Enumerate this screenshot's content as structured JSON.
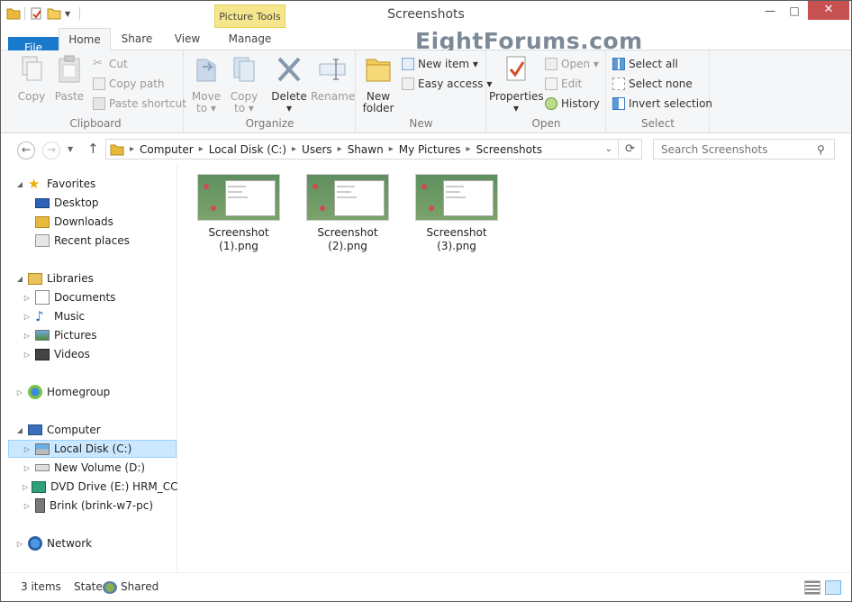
{
  "window": {
    "title": "Screenshots",
    "context_tab": "Picture Tools",
    "minimize_label": "—",
    "maximize_label": "□",
    "close_label": "✕"
  },
  "tabs": [
    "File",
    "Home",
    "Share",
    "View",
    "Manage"
  ],
  "watermark": "EightForums.com",
  "ribbon": {
    "clipboard": {
      "label": "Clipboard",
      "copy": "Copy",
      "paste": "Paste",
      "cut": "Cut",
      "copy_path": "Copy path",
      "paste_shortcut": "Paste shortcut"
    },
    "organize": {
      "label": "Organize",
      "move_to": [
        "Move",
        "to ▾"
      ],
      "copy_to": [
        "Copy",
        "to ▾"
      ],
      "delete": [
        "Delete",
        "▾"
      ],
      "rename": "Rename"
    },
    "new": {
      "label": "New",
      "new_folder": [
        "New",
        "folder"
      ],
      "new_item": "New item ▾",
      "easy_access": "Easy access ▾"
    },
    "open": {
      "label": "Open",
      "properties": [
        "Properties",
        "▾"
      ],
      "open": "Open ▾",
      "edit": "Edit",
      "history": "History"
    },
    "select": {
      "label": "Select",
      "select_all": "Select all",
      "select_none": "Select none",
      "invert_selection": "Invert selection"
    }
  },
  "address": {
    "crumbs": [
      "Computer",
      "Local Disk (C:)",
      "Users",
      "Shawn",
      "My Pictures",
      "Screenshots"
    ],
    "search_placeholder": "Search Screenshots"
  },
  "nav": {
    "favorites": "Favorites",
    "desktop": "Desktop",
    "downloads": "Downloads",
    "recent": "Recent places",
    "libraries": "Libraries",
    "documents": "Documents",
    "music": "Music",
    "pictures": "Pictures",
    "videos": "Videos",
    "homegroup": "Homegroup",
    "computer": "Computer",
    "local_disk": "Local Disk (C:)",
    "new_volume": "New Volume (D:)",
    "dvd": "DVD Drive (E:) HRM_CCSA",
    "brink": "Brink (brink-w7-pc)",
    "network": "Network"
  },
  "files": [
    {
      "line1": "Screenshot",
      "line2": "(1).png"
    },
    {
      "line1": "Screenshot",
      "line2": "(2).png"
    },
    {
      "line1": "Screenshot",
      "line2": "(3).png"
    }
  ],
  "status": {
    "items": "3 items",
    "state_label": "State:",
    "state_value": "Shared"
  }
}
